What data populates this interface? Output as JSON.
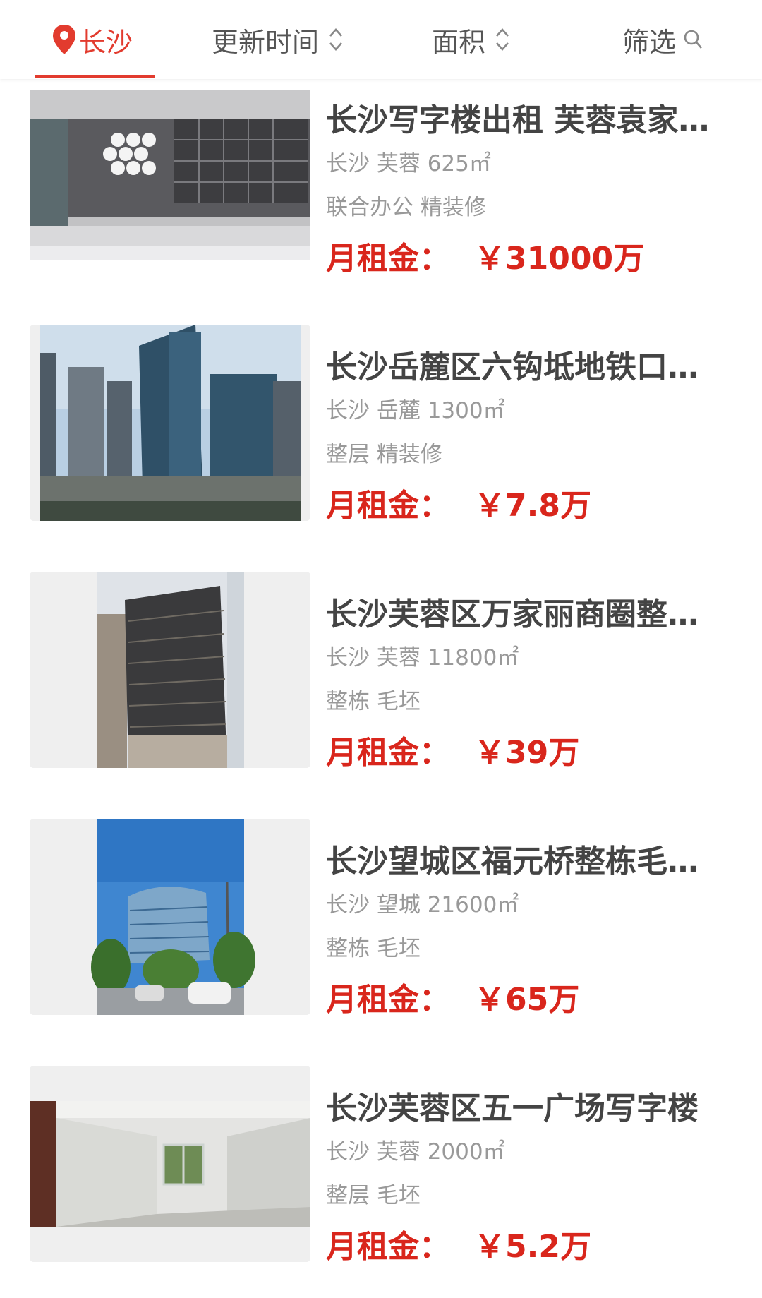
{
  "nav": {
    "location": "长沙",
    "sort_time": "更新时间",
    "sort_area": "面积",
    "filter": "筛选"
  },
  "colors": {
    "accent": "#e23b2e",
    "price": "#d9261c"
  },
  "listings": [
    {
      "title": "长沙写字楼出租 芙蓉袁家岭写字楼",
      "meta": "长沙 芙蓉 625㎡",
      "tags": "联合办公 精装修",
      "price_label": "月租金：",
      "price": "￥31000万",
      "image": "lobby-welcome-photo"
    },
    {
      "title": "长沙岳麓区六钩坻地铁口写字楼",
      "meta": "长沙 岳麓 1300㎡",
      "tags": "整层 精装修",
      "price_label": "月租金：",
      "price": "￥7.8万",
      "image": "glass-towers-photo"
    },
    {
      "title": "长沙芙蓉区万家丽商圈整栋写字楼",
      "meta": "长沙 芙蓉 11800㎡",
      "tags": "整栋 毛坯",
      "price_label": "月租金：",
      "price": "￥39万",
      "image": "office-tower-photo"
    },
    {
      "title": "长沙望城区福元桥整栋毛坯写字楼",
      "meta": "长沙 望城 21600㎡",
      "tags": "整栋 毛坯",
      "price_label": "月租金：",
      "price": "￥65万",
      "image": "curved-building-photo"
    },
    {
      "title": "长沙芙蓉区五一广场写字楼",
      "meta": "长沙 芙蓉 2000㎡",
      "tags": "整层 毛坯",
      "price_label": "月租金：",
      "price": "￥5.2万",
      "image": "empty-room-photo"
    }
  ]
}
